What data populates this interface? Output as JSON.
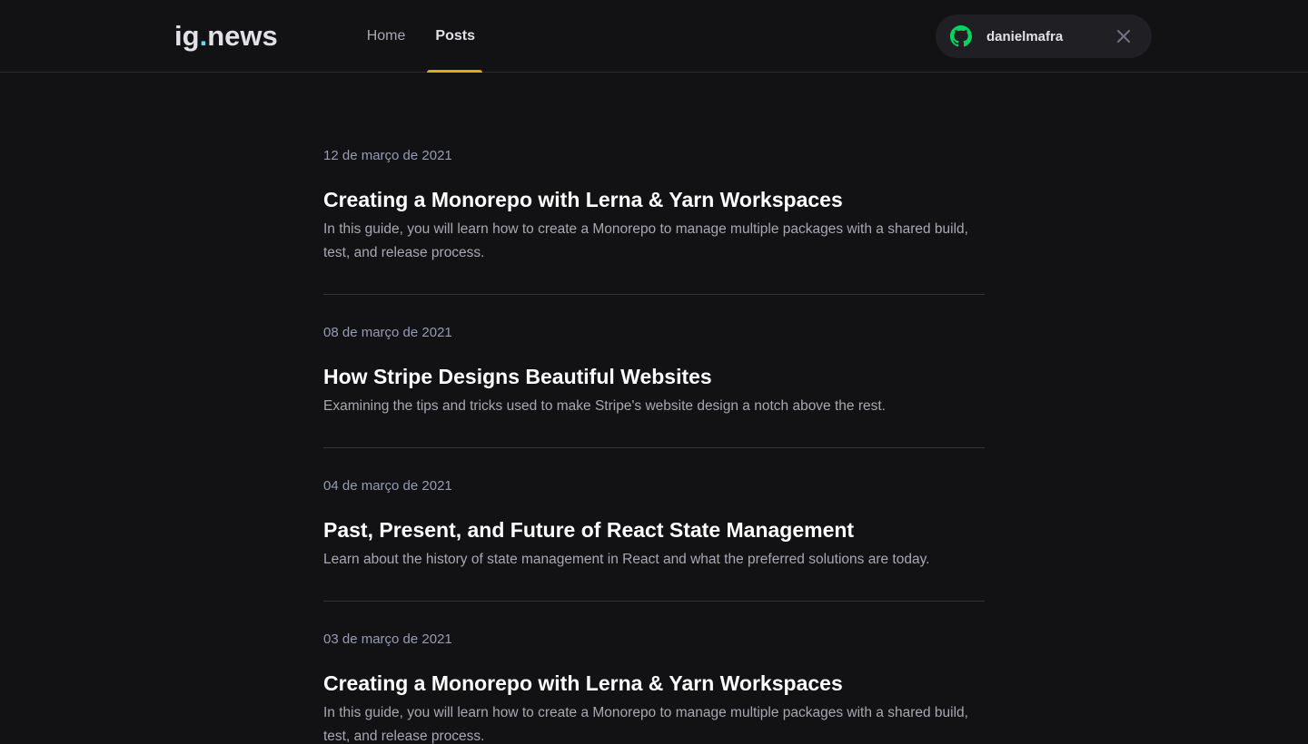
{
  "header": {
    "logo_main": "ig",
    "logo_dot": ".",
    "logo_suffix": "news",
    "nav": [
      {
        "label": "Home",
        "active": false
      },
      {
        "label": "Posts",
        "active": true
      }
    ],
    "user": {
      "username": "danielmafra",
      "icon": "github-icon",
      "icon_color": "#04d361",
      "close_icon": "close-icon"
    }
  },
  "colors": {
    "background": "#121214",
    "accent": "#eba417",
    "logo_dot": "#61dafb"
  },
  "posts": [
    {
      "date": "12 de março de 2021",
      "title": "Creating a Monorepo with Lerna & Yarn Workspaces",
      "excerpt": "In this guide, you will learn how to create a Monorepo to manage multiple packages with a shared build, test, and release process."
    },
    {
      "date": "08 de março de 2021",
      "title": "How Stripe Designs Beautiful Websites",
      "excerpt": "Examining the tips and tricks used to make Stripe's website design a notch above the rest."
    },
    {
      "date": "04 de março de 2021",
      "title": "Past, Present, and Future of React State Management",
      "excerpt": "Learn about the history of state management in React and what the preferred solutions are today."
    },
    {
      "date": "03 de março de 2021",
      "title": "Creating a Monorepo with Lerna & Yarn Workspaces",
      "excerpt": "In this guide, you will learn how to create a Monorepo to manage multiple packages with a shared build, test, and release process."
    }
  ]
}
